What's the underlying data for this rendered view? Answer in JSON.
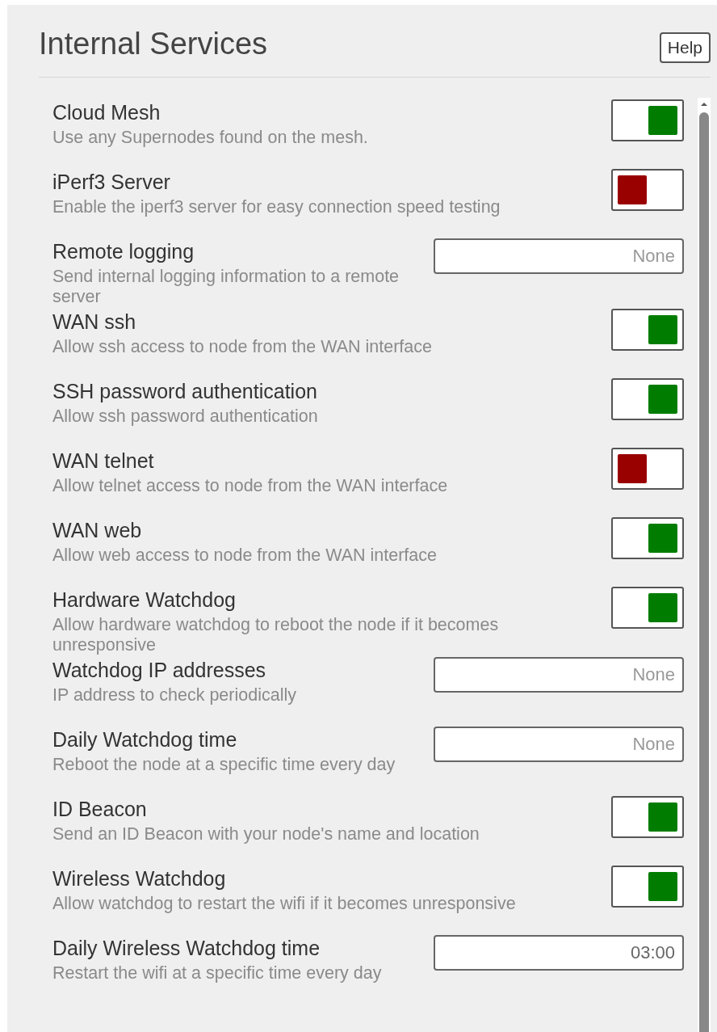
{
  "title": "Internal Services",
  "help_button": "Help",
  "settings": [
    {
      "kind": "toggle",
      "label": "Cloud Mesh",
      "description": "Use any Supernodes found on the mesh.",
      "on": true
    },
    {
      "kind": "toggle",
      "label": "iPerf3 Server",
      "description": "Enable the iperf3 server for easy connection speed testing",
      "on": false
    },
    {
      "kind": "field",
      "label": "Remote logging",
      "description": "Send internal logging information to a remote server",
      "placeholder": "None"
    },
    {
      "kind": "toggle",
      "label": "WAN ssh",
      "description": "Allow ssh access to node from the WAN interface",
      "on": true
    },
    {
      "kind": "toggle",
      "label": "SSH password authentication",
      "description": "Allow ssh password authentication",
      "on": true
    },
    {
      "kind": "toggle",
      "label": "WAN telnet",
      "description": "Allow telnet access to node from the WAN interface",
      "on": false
    },
    {
      "kind": "toggle",
      "label": "WAN web",
      "description": "Allow web access to node from the WAN interface",
      "on": true
    },
    {
      "kind": "toggle",
      "label": "Hardware Watchdog",
      "description": "Allow hardware watchdog to reboot the node if it becomes unresponsive",
      "on": true
    },
    {
      "kind": "field",
      "label": "Watchdog IP addresses",
      "description": "IP address to check periodically",
      "placeholder": "None"
    },
    {
      "kind": "field",
      "label": "Daily Watchdog time",
      "description": "Reboot the node at a specific time every day",
      "placeholder": "None"
    },
    {
      "kind": "toggle",
      "label": "ID Beacon",
      "description": "Send an ID Beacon with your node's name and location",
      "on": true
    },
    {
      "kind": "toggle",
      "label": "Wireless Watchdog",
      "description": "Allow watchdog to restart the wifi if it becomes unresponsive",
      "on": true
    },
    {
      "kind": "field",
      "label": "Daily Wireless Watchdog time",
      "description": "Restart the wifi at a specific time every day",
      "value": "03:00"
    }
  ]
}
